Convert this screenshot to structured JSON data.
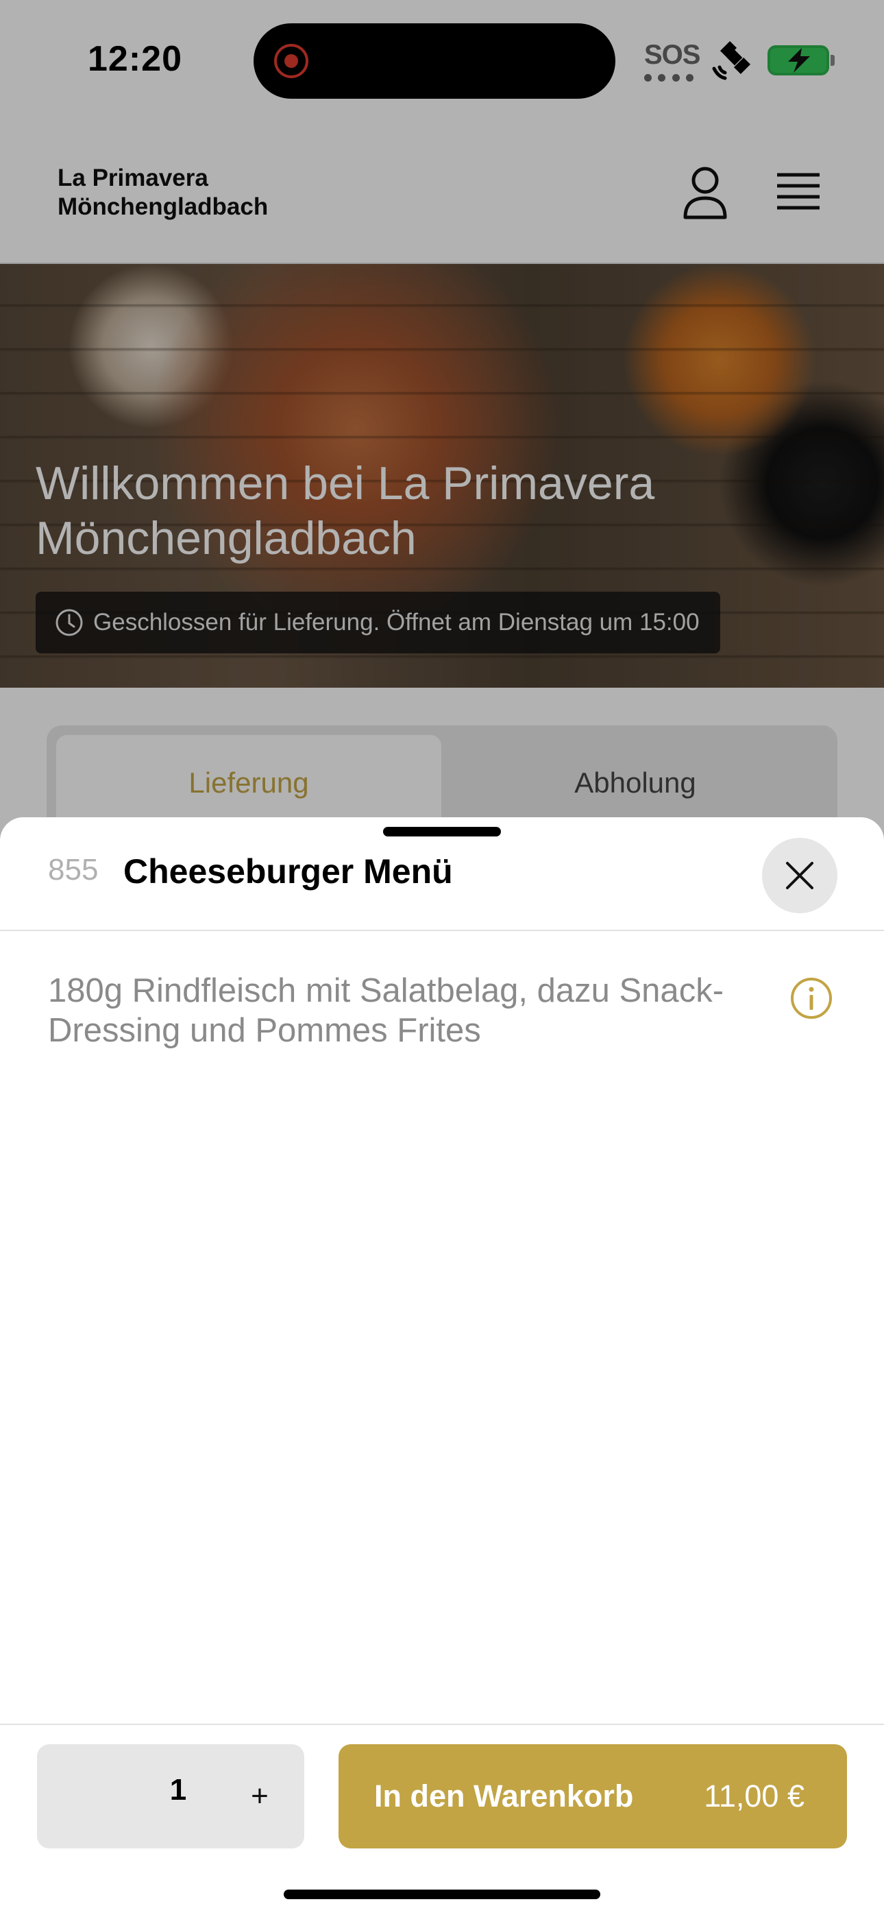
{
  "status_bar": {
    "time": "12:20",
    "sos": "SOS",
    "icons": [
      "record-icon",
      "satellite-icon",
      "battery-charging-icon"
    ],
    "battery_color": "#34c759"
  },
  "header": {
    "brand_line1": "La Primavera",
    "brand_line2": "Mönchengladbach",
    "icons": [
      "user-icon",
      "hamburger-menu-icon"
    ]
  },
  "hero": {
    "title_line1": "Willkommen bei La Primavera",
    "title_line2": "Mönchengladbach",
    "notice": "Geschlossen für Lieferung. Öffnet am Dienstag um 15:00"
  },
  "order_mode": {
    "tabs": [
      {
        "label": "Lieferung",
        "active": true
      },
      {
        "label": "Abholung",
        "active": false
      }
    ]
  },
  "sheet": {
    "item_number": "855",
    "item_title": "Cheeseburger Menü",
    "description": "180g Rindfleisch mit Salatbelag, dazu Snack-Dressing und Pommes Frites",
    "quantity": "1",
    "plus_label": "+",
    "add_to_cart_label": "In den Warenkorb",
    "price": "11,00 €"
  },
  "colors": {
    "accent": "#c2a445",
    "overlay": "rgba(0,0,0,0.3)"
  }
}
